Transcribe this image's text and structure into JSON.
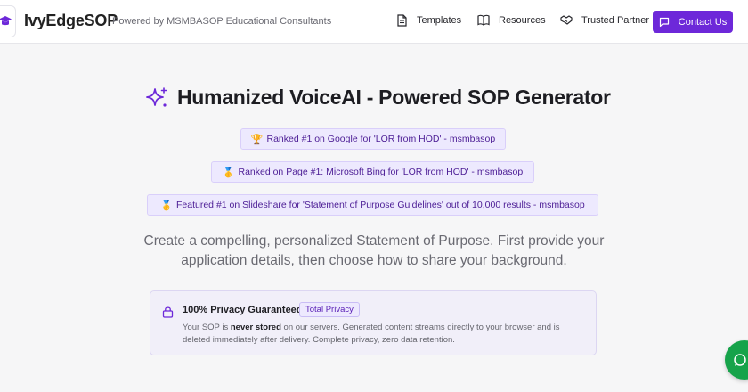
{
  "header": {
    "brand": "IvyEdgeSOP",
    "tagline": "Powered by MSMBASOP Educational Consultants",
    "nav": [
      {
        "label": "Templates",
        "icon": "document-icon"
      },
      {
        "label": "Resources",
        "icon": "book-open-icon"
      },
      {
        "label": "Trusted Partner",
        "icon": "handshake-icon"
      }
    ],
    "contact_label": "Contact Us",
    "contact_icon": "chat-bubble-icon"
  },
  "hero": {
    "title": "Humanized VoiceAI - Powered SOP Generator",
    "title_icon": "sparkles-icon",
    "badges": [
      {
        "icon": "trophy-icon",
        "text": "Ranked #1 on Google for 'LOR from HOD' - msmbasop"
      },
      {
        "icon": "medal-icon",
        "text": "Ranked on Page #1: Microsoft Bing for 'LOR from HOD' - msmbasop"
      },
      {
        "icon": "medal-icon",
        "text": "Featured #1 on Slideshare for 'Statement of Purpose Guidelines' out of 10,000 results - msmbasop"
      }
    ],
    "intro_line1": "Create a compelling, personalized Statement of Purpose. First provide your",
    "intro_line2": "application details, then choose how to share your background."
  },
  "privacy": {
    "title": "100% Privacy Guaranteed",
    "pill": "Total Privacy",
    "text_before": "Your SOP is ",
    "text_bold": "never stored",
    "text_after": " on our servers. Generated content streams directly to your browser and is deleted immediately after delivery. Complete privacy, zero data retention."
  },
  "colors": {
    "accent": "#6d28d9",
    "badge_bg": "#ede9fe",
    "chat_fab": "#16a34a"
  }
}
